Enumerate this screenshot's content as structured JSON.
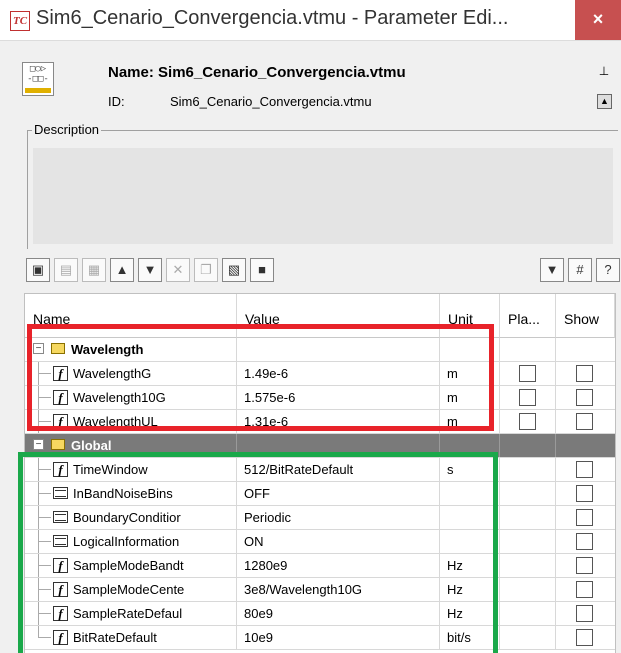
{
  "window": {
    "title": "Sim6_Cenario_Convergencia.vtmu - Parameter Edi...",
    "close_glyph": "×",
    "app_icon_text": "TC"
  },
  "header": {
    "name_label": "Name: Sim6_Cenario_Convergencia.vtmu",
    "id_label": "ID:",
    "id_value": "Sim6_Cenario_Convergencia.vtmu"
  },
  "description": {
    "legend": "Description"
  },
  "toolbar": {
    "icons": [
      "new-folder-icon",
      "new-param-icon",
      "properties-icon",
      "move-up-icon",
      "move-down-icon",
      "delete-icon",
      "copy-icon",
      "import-icon",
      "save-icon",
      "filter-icon",
      "grid-icon",
      "help-icon"
    ]
  },
  "table": {
    "columns": [
      "Name",
      "Value",
      "Unit",
      "Pla...",
      "Show"
    ],
    "groups": [
      {
        "name": "Wavelength",
        "rows": [
          {
            "icon": "function",
            "name": "WavelengthG",
            "value": "1.49e-6",
            "unit": "m"
          },
          {
            "icon": "function",
            "name": "Wavelength10G",
            "value": "1.575e-6",
            "unit": "m"
          },
          {
            "icon": "function",
            "name": "WavelengthUL",
            "value": "1.31e-6",
            "unit": "m"
          }
        ]
      },
      {
        "name": "Global",
        "rows": [
          {
            "icon": "function",
            "name": "TimeWindow",
            "value": "512/BitRateDefault",
            "unit": "s"
          },
          {
            "icon": "list",
            "name": "InBandNoiseBins",
            "value": "OFF",
            "unit": ""
          },
          {
            "icon": "list",
            "name": "BoundaryConditior",
            "value": "Periodic",
            "unit": ""
          },
          {
            "icon": "list",
            "name": "LogicalInformation",
            "value": "ON",
            "unit": ""
          },
          {
            "icon": "function",
            "name": "SampleModeBandt",
            "value": "1280e9",
            "unit": "Hz"
          },
          {
            "icon": "function",
            "name": "SampleModeCente",
            "value": "3e8/Wavelength10G",
            "unit": "Hz"
          },
          {
            "icon": "function",
            "name": "SampleRateDefaul",
            "value": "80e9",
            "unit": "Hz"
          },
          {
            "icon": "function",
            "name": "BitRateDefault",
            "value": "10e9",
            "unit": "bit/s"
          }
        ]
      }
    ]
  },
  "annotations": {
    "red_box_color": "#e8232a",
    "green_box_color": "#1aa84a"
  }
}
